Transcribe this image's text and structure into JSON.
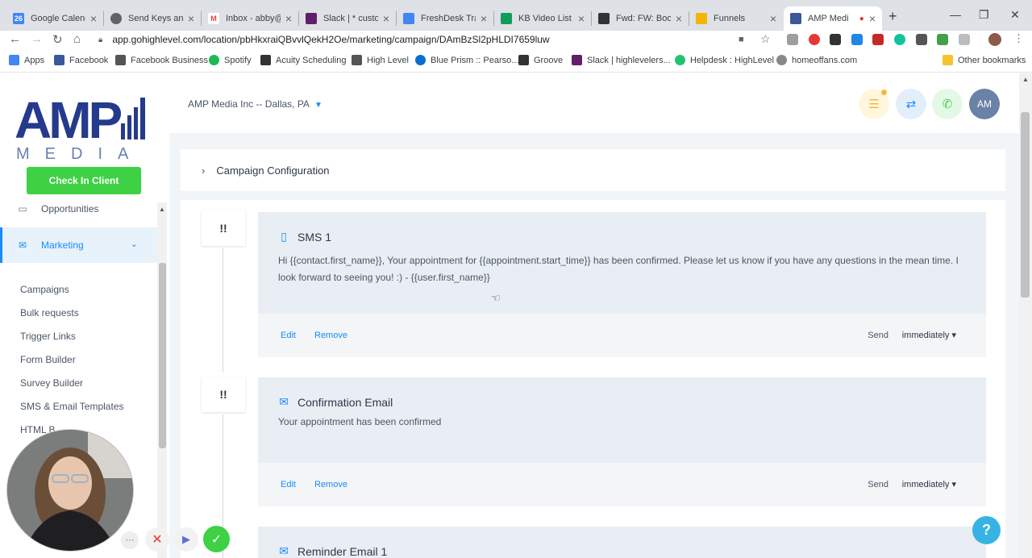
{
  "browser": {
    "tabs": [
      {
        "title": "Google Calendar",
        "fav_color": "#4285f4",
        "fav_text": "26"
      },
      {
        "title": "Send Keys and",
        "fav_color": "#5f6368",
        "fav_text": ""
      },
      {
        "title": "Inbox - abby@",
        "fav_color": "#ea4335",
        "fav_text": "M"
      },
      {
        "title": "Slack | * custom",
        "fav_color": "#611f69",
        "fav_text": ""
      },
      {
        "title": "FreshDesk Tran",
        "fav_color": "#4285f4",
        "fav_text": ""
      },
      {
        "title": "KB Video List -",
        "fav_color": "#0f9d58",
        "fav_text": ""
      },
      {
        "title": "Fwd: FW: Book",
        "fav_color": "#333333",
        "fav_text": ""
      },
      {
        "title": "Funnels",
        "fav_color": "#f4b400",
        "fav_text": ""
      },
      {
        "title": "AMP Medi",
        "fav_color": "#3b5998",
        "fav_text": ""
      }
    ],
    "url": "app.gohighlevel.com/location/pbHkxraiQBvvlQekH2Oe/marketing/campaign/DAmBzSl2pHLDI7659luw",
    "bookmarks": [
      {
        "label": "Apps",
        "color": "#4285f4"
      },
      {
        "label": "Facebook",
        "color": "#3b5998"
      },
      {
        "label": "Facebook Business",
        "color": "#555555"
      },
      {
        "label": "Spotify",
        "color": "#1db954"
      },
      {
        "label": "Acuity Scheduling",
        "color": "#333333"
      },
      {
        "label": "High Level",
        "color": "#555555"
      },
      {
        "label": "Blue Prism :: Pearso...",
        "color": "#0a6ed1"
      },
      {
        "label": "Groove",
        "color": "#333333"
      },
      {
        "label": "Slack | highlevelers...",
        "color": "#611f69"
      },
      {
        "label": "Helpdesk : HighLevel",
        "color": "#25c16f"
      },
      {
        "label": "homeoffans.com",
        "color": "#888888"
      },
      {
        "label": "Other bookmarks",
        "color": "#f4c430"
      }
    ]
  },
  "sidebar": {
    "logo_top": "AMP",
    "logo_bottom": "M E D I A",
    "checkin_label": "Check In Client",
    "opportunities_label": "Opportunities",
    "marketing_label": "Marketing",
    "sub_items": [
      "Campaigns",
      "Bulk requests",
      "Trigger Links",
      "Form Builder",
      "Survey Builder",
      "SMS & Email Templates",
      "HTML B"
    ]
  },
  "header": {
    "location": "AMP Media Inc -- Dallas, PA",
    "avatar_initials": "AM"
  },
  "campaign": {
    "config_label": "Campaign Configuration",
    "steps": [
      {
        "type": "sms",
        "title": "SMS 1",
        "message": "Hi {{contact.first_name}}, Your appointment for {{appointment.start_time}} has been confirmed. Please let us know if you have any questions in the mean time. I look forward to seeing you! :) - {{user.first_name}}",
        "edit": "Edit",
        "remove": "Remove",
        "send_label": "Send",
        "send_value": "immediately ▾"
      },
      {
        "type": "email",
        "title": "Confirmation Email",
        "message": "Your appointment has been confirmed",
        "edit": "Edit",
        "remove": "Remove",
        "send_label": "Send",
        "send_value": "immediately ▾"
      },
      {
        "type": "email",
        "title": "Reminder Email 1"
      }
    ]
  },
  "help_label": "?",
  "colors": {
    "accent": "#188bf6",
    "checkin": "#3dd143",
    "help": "#37b3e3"
  }
}
